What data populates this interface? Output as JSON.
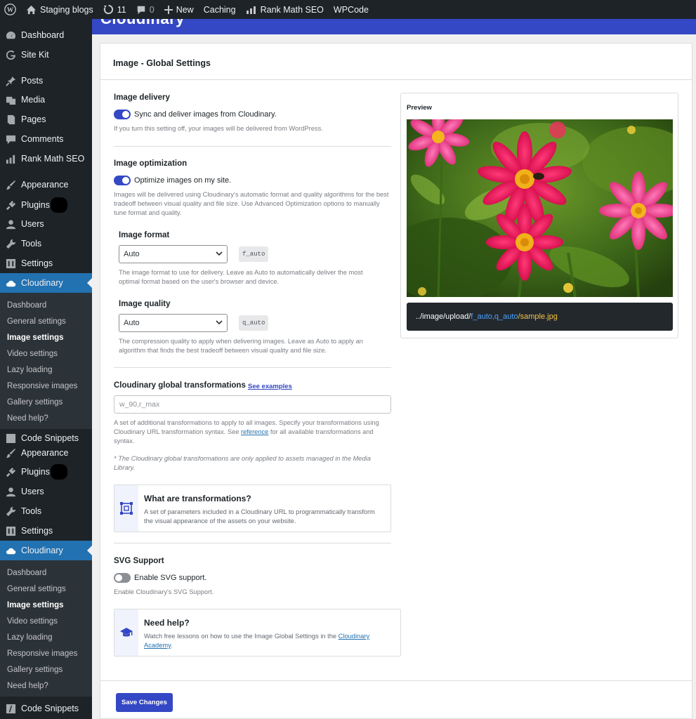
{
  "adminbar": {
    "site_name": "Staging blogs",
    "updates_count": "11",
    "comments_count": "0",
    "new_label": "New",
    "caching_label": "Caching",
    "rankmath_label": "Rank Math SEO",
    "wpcode_label": "WPCode"
  },
  "sidebar": {
    "dashboard": "Dashboard",
    "sitekit": "Site Kit",
    "posts": "Posts",
    "media": "Media",
    "pages": "Pages",
    "comments": "Comments",
    "rankmath": "Rank Math SEO",
    "appearance": "Appearance",
    "plugins": "Plugins",
    "users": "Users",
    "tools": "Tools",
    "settings": "Settings",
    "cloudinary": "Cloudinary",
    "code_snippets": "Code Snippets",
    "submenu": [
      "Dashboard",
      "General settings",
      "Image settings",
      "Video settings",
      "Lazy loading",
      "Responsive images",
      "Gallery settings",
      "Need help?"
    ]
  },
  "banner": {
    "logo": "Cloudinary"
  },
  "panel": {
    "title": "Image - Global Settings",
    "delivery": {
      "heading": "Image delivery",
      "toggle_label": "Sync and deliver images from Cloudinary.",
      "toggle_on": true,
      "desc": "If you turn this setting off, your images will be delivered from WordPress."
    },
    "optimization": {
      "heading": "Image optimization",
      "toggle_label": "Optimize images on my site.",
      "toggle_on": true,
      "desc": "Images will be delivered using Cloudinary's automatic format and quality algorithms for the best tradeoff between visual quality and file size. Use Advanced Optimization options to manually tune format and quality."
    },
    "format": {
      "heading": "Image format",
      "value": "Auto",
      "code": "f_auto",
      "desc": "The image format to use for delivery. Leave as Auto to automatically deliver the most optimal format based on the user's browser and device."
    },
    "quality": {
      "heading": "Image quality",
      "value": "Auto",
      "code": "q_auto",
      "desc": "The compression quality to apply when delivering images. Leave as Auto to apply an algorithm that finds the best tradeoff between visual quality and file size."
    },
    "transformations": {
      "heading": "Cloudinary global transformations",
      "examples_link": "See examples",
      "input_placeholder": "w_90,r_max",
      "desc_pre": "A set of additional transformations to apply to all images. Specify your transformations using Cloudinary URL transformation syntax. See",
      "desc_link": "reference",
      "desc_post": "for all available transformations and syntax.",
      "note": "* The Cloudinary global transformations are only applied to assets managed in the Media Library."
    },
    "what_card": {
      "title": "What are transformations?",
      "text": "A set of parameters included in a Cloudinary URL to programmatically transform the visual appearance of the assets on your website."
    },
    "svg": {
      "heading": "SVG Support",
      "toggle_label": "Enable SVG support.",
      "toggle_on": false,
      "desc": "Enable Cloudinary's SVG Support."
    },
    "help_card": {
      "title": "Need help?",
      "text_pre": "Watch free lessons on how to use the Image Global Settings in the",
      "link": "Cloudinary Academy",
      "text_post": "."
    },
    "preview": {
      "title": "Preview",
      "url_prefix": "../image/upload/",
      "url_transform": "f_auto,q_auto",
      "url_file": "/sample.jpg"
    },
    "save_label": "Save Changes"
  },
  "colors": {
    "accent": "#3448c5",
    "sidebar_bg": "#1d2327",
    "active_menu": "#2271b1",
    "url_transform": "#4aa3ff",
    "url_file": "#f5c542"
  }
}
